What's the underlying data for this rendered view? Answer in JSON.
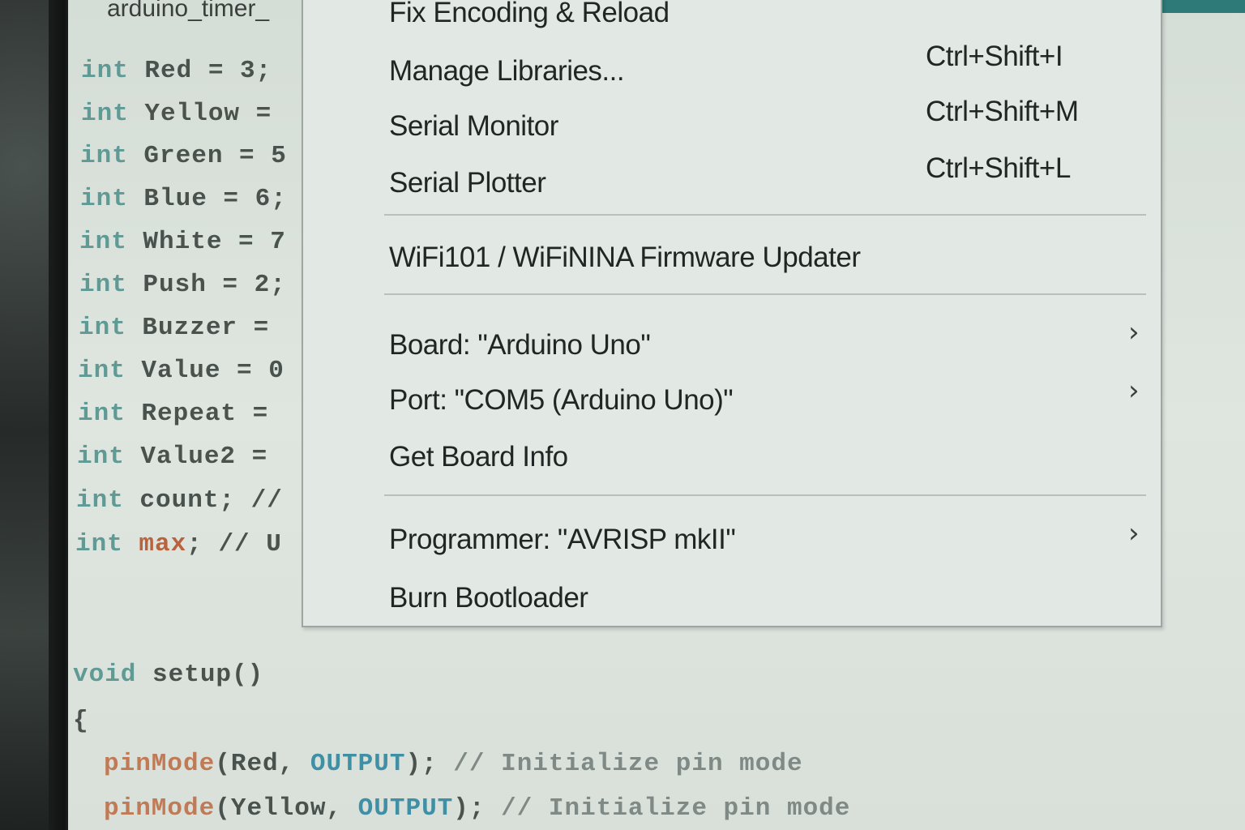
{
  "tab": {
    "title": "arduino_timer_"
  },
  "code_lines": [
    {
      "kw": "int",
      "text": " Red = 3;"
    },
    {
      "kw": "int",
      "text": " Yellow ="
    },
    {
      "kw": "int",
      "text": " Green = 5"
    },
    {
      "kw": "int",
      "text": " Blue = 6;"
    },
    {
      "kw": "int",
      "text": " White = 7"
    },
    {
      "kw": "int",
      "text": " Push = 2;"
    },
    {
      "kw": "int",
      "text": " Buzzer ="
    },
    {
      "kw": "int",
      "text": " Value = 0"
    },
    {
      "kw": "int",
      "text": " Repeat ="
    },
    {
      "kw": "int",
      "text": " Value2 ="
    },
    {
      "kw": "int",
      "text": " count; //"
    },
    {
      "kw": "int",
      "name": "max",
      "rest": "; // U"
    }
  ],
  "setup": {
    "kw": "void",
    "name": " setup()",
    "brace": "{",
    "lines": [
      {
        "fn": "pinMode",
        "args_open": "(Red, ",
        "const": "OUTPUT",
        "args_close": "); ",
        "comment": "// Initialize pin mode"
      },
      {
        "fn": "pinMode",
        "args_open": "(Yellow, ",
        "const": "OUTPUT",
        "args_close": "); ",
        "comment": "// Initialize pin mode"
      }
    ]
  },
  "menu": {
    "items": [
      {
        "label": "Fix Encoding & Reload",
        "shortcut": ""
      },
      {
        "label": "Manage Libraries...",
        "shortcut": "Ctrl+Shift+I"
      },
      {
        "label": "Serial Monitor",
        "shortcut": "Ctrl+Shift+M"
      },
      {
        "label": "Serial Plotter",
        "shortcut": "Ctrl+Shift+L"
      },
      {
        "label": "WiFi101 / WiFiNINA Firmware Updater",
        "shortcut": ""
      },
      {
        "label": "Board: \"Arduino Uno\"",
        "shortcut": "",
        "submenu": "chevron-right-icon"
      },
      {
        "label": "Port: \"COM5 (Arduino Uno)\"",
        "shortcut": "",
        "submenu": "chevron-right-icon"
      },
      {
        "label": "Get Board Info",
        "shortcut": ""
      },
      {
        "label": "Programmer: \"AVRISP mkII\"",
        "shortcut": "",
        "submenu": "chevron-right-icon"
      },
      {
        "label": "Burn Bootloader",
        "shortcut": ""
      }
    ],
    "arrow_glyph": "›"
  }
}
